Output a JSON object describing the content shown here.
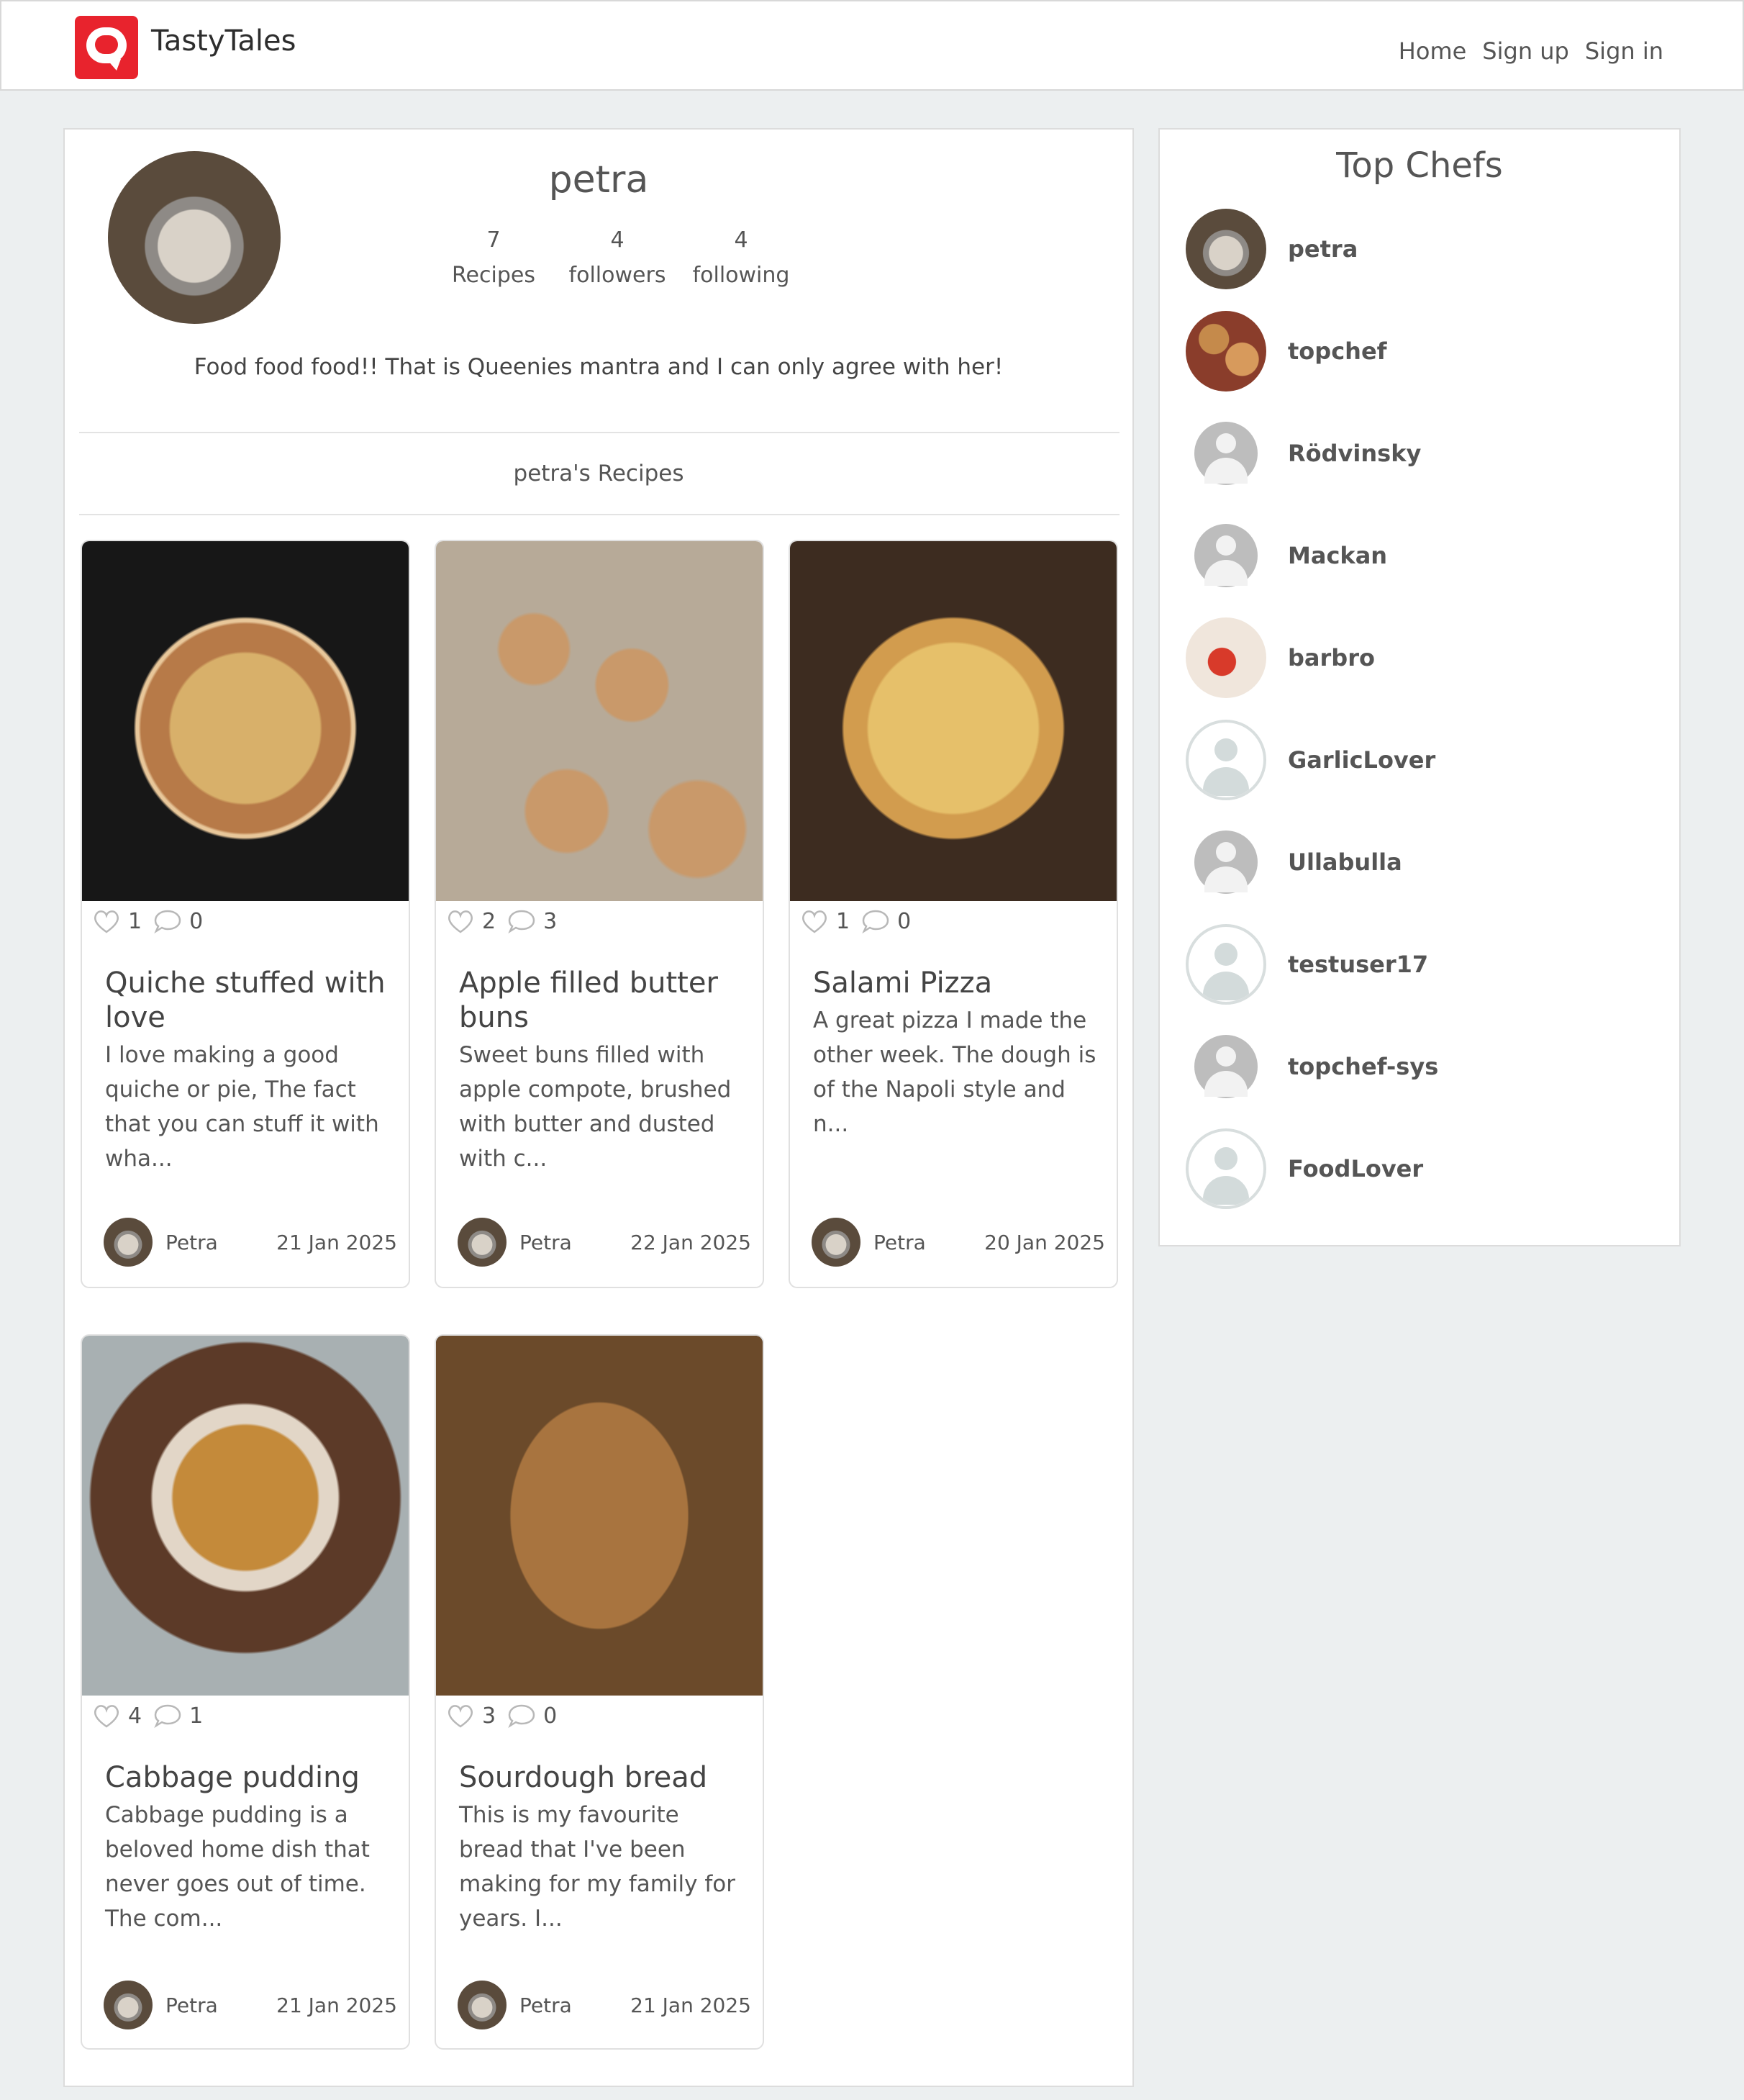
{
  "app": {
    "brand": "TastyTales"
  },
  "nav": {
    "home": "Home",
    "signup": "Sign up",
    "signin": "Sign in"
  },
  "profile": {
    "username": "petra",
    "stats": [
      {
        "value": "7",
        "label": "Recipes"
      },
      {
        "value": "4",
        "label": "followers"
      },
      {
        "value": "4",
        "label": "following"
      }
    ],
    "bio": "Food food food!! That is Queenies mantra and I can only agree with her!",
    "section_title": "petra's Recipes"
  },
  "recipes": [
    {
      "likes": "1",
      "comments": "0",
      "title": "Quiche stuffed with love",
      "description": "I love making a good quiche or pie, The fact that you can stuff it with wha...",
      "author": "Petra",
      "date": "21 Jan 2025"
    },
    {
      "likes": "2",
      "comments": "3",
      "title": "Apple filled butter buns",
      "description": "Sweet buns filled with apple compote, brushed with butter and dusted with c...",
      "author": "Petra",
      "date": "22 Jan 2025"
    },
    {
      "likes": "1",
      "comments": "0",
      "title": "Salami Pizza",
      "description": "A great pizza I made the other week. The dough is of the Napoli style and n...",
      "author": "Petra",
      "date": "20 Jan 2025"
    },
    {
      "likes": "4",
      "comments": "1",
      "title": "Cabbage pudding",
      "description": "Cabbage pudding is a beloved home dish that never goes out of time. The com...",
      "author": "Petra",
      "date": "21 Jan 2025"
    },
    {
      "likes": "3",
      "comments": "0",
      "title": "Sourdough bread",
      "description": "This is my favourite bread that I've been making for my family for years. I...",
      "author": "Petra",
      "date": "21 Jan 2025"
    }
  ],
  "sidebar": {
    "title": "Top Chefs",
    "chefs": [
      {
        "name": "petra"
      },
      {
        "name": "topchef"
      },
      {
        "name": "Rödvinsky"
      },
      {
        "name": "Mackan"
      },
      {
        "name": "barbro"
      },
      {
        "name": "GarlicLover"
      },
      {
        "name": "Ullabulla"
      },
      {
        "name": "testuser17"
      },
      {
        "name": "topchef-sys"
      },
      {
        "name": "FoodLover"
      }
    ]
  },
  "colors": {
    "brand_red": "#e8232d",
    "background": "#eceff0"
  }
}
